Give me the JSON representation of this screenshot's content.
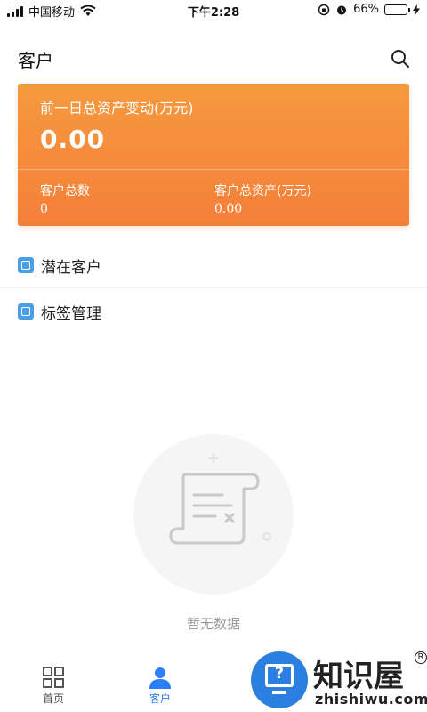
{
  "status_bar": {
    "carrier": "中国移动",
    "time": "下午2:28",
    "battery_percent": "66%",
    "battery_level": 0.66,
    "battery_color": "#35c759"
  },
  "header": {
    "title": "客户",
    "search_icon": "search-icon"
  },
  "summary_card": {
    "label": "前一日总资产变动(万元)",
    "value": "0.00",
    "stats": [
      {
        "label": "客户总数",
        "value": "0"
      },
      {
        "label": "客户总资产(万元)",
        "value": "0.00"
      }
    ],
    "gradient": [
      "#f59a3e",
      "#f57f3a"
    ]
  },
  "menu": {
    "items": [
      {
        "label": "潜在客户",
        "icon": "potential-customer-icon"
      },
      {
        "label": "标签管理",
        "icon": "tag-management-icon"
      }
    ]
  },
  "empty_state": {
    "text": "暂无数据",
    "icon": "empty-scroll-icon"
  },
  "tab_bar": {
    "active_color": "#2d7ff9",
    "tabs": [
      {
        "label": "首页",
        "icon": "grid-icon",
        "active": false
      },
      {
        "label": "客户",
        "icon": "person-icon",
        "active": true
      }
    ]
  },
  "watermark": {
    "name": "知识屋",
    "domain": "zhishiwu.com",
    "mark": "R",
    "symbol": "?"
  }
}
